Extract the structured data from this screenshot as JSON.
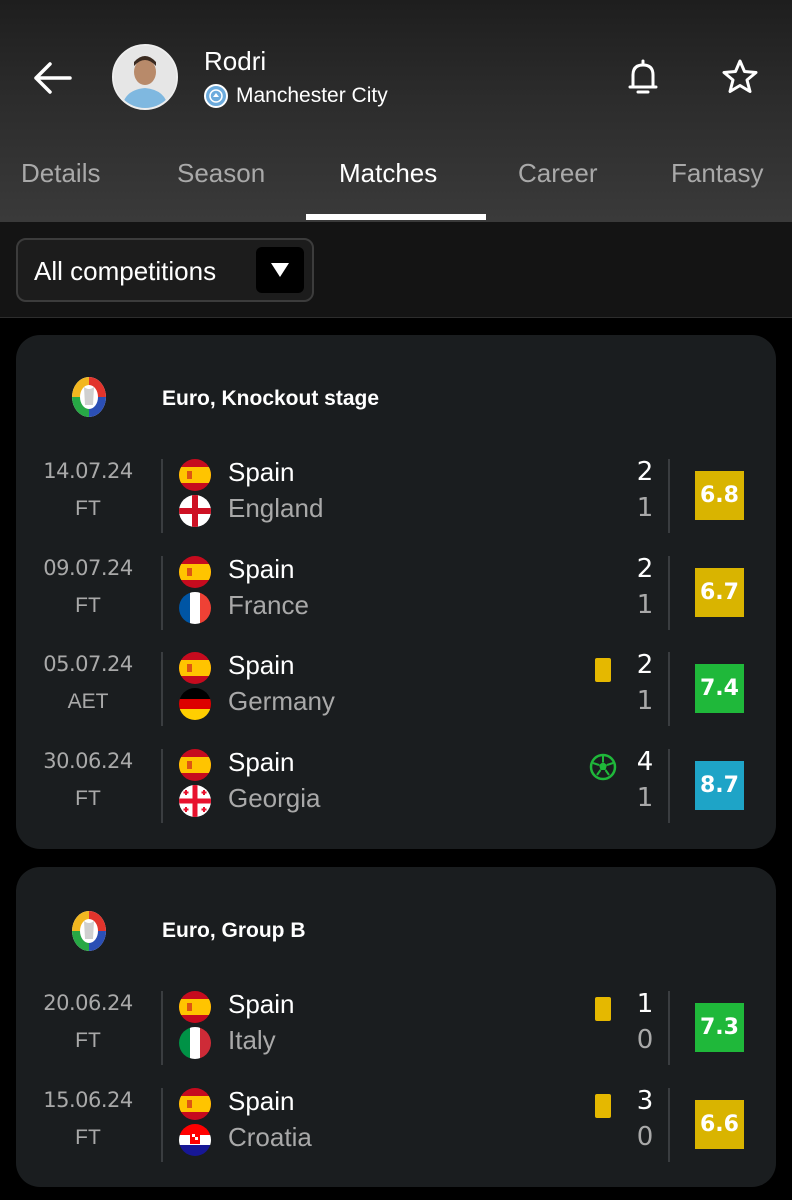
{
  "header": {
    "player_name": "Rodri",
    "club_name": "Manchester City",
    "icons": {
      "back": "arrow-left-icon",
      "bell": "bell-icon",
      "favorite": "star-icon"
    }
  },
  "tabs": [
    {
      "label": "Details"
    },
    {
      "label": "Season"
    },
    {
      "label": "Matches",
      "active": true
    },
    {
      "label": "Career"
    },
    {
      "label": "Fantasy"
    }
  ],
  "filter": {
    "label": "All competitions"
  },
  "rating_colors": {
    "yellow": "#d9b400",
    "green": "#1fb83a",
    "blue": "#1ea4c7"
  },
  "competitions": [
    {
      "title": "Euro, Knockout stage",
      "matches": [
        {
          "date": "14.07.24",
          "status": "FT",
          "home": "Spain",
          "away": "England",
          "home_score": "2",
          "away_score": "1",
          "event": "",
          "rating": "6.8",
          "rating_color": "#d9b400"
        },
        {
          "date": "09.07.24",
          "status": "FT",
          "home": "Spain",
          "away": "France",
          "home_score": "2",
          "away_score": "1",
          "event": "",
          "rating": "6.7",
          "rating_color": "#d9b400"
        },
        {
          "date": "05.07.24",
          "status": "AET",
          "home": "Spain",
          "away": "Germany",
          "home_score": "2",
          "away_score": "1",
          "event": "yellow-card",
          "rating": "7.4",
          "rating_color": "#1fb83a"
        },
        {
          "date": "30.06.24",
          "status": "FT",
          "home": "Spain",
          "away": "Georgia",
          "home_score": "4",
          "away_score": "1",
          "event": "goal",
          "rating": "8.7",
          "rating_color": "#1ea4c7"
        }
      ]
    },
    {
      "title": "Euro, Group B",
      "matches": [
        {
          "date": "20.06.24",
          "status": "FT",
          "home": "Spain",
          "away": "Italy",
          "home_score": "1",
          "away_score": "0",
          "event": "yellow-card",
          "rating": "7.3",
          "rating_color": "#1fb83a"
        },
        {
          "date": "15.06.24",
          "status": "FT",
          "home": "Spain",
          "away": "Croatia",
          "home_score": "3",
          "away_score": "0",
          "event": "yellow-card",
          "rating": "6.6",
          "rating_color": "#d9b400"
        }
      ]
    }
  ]
}
